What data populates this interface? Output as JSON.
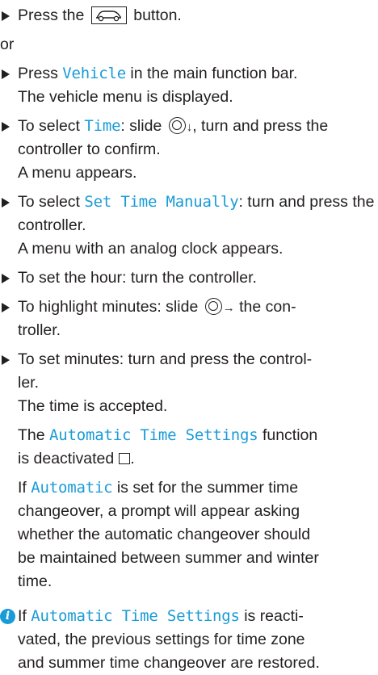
{
  "steps": [
    {
      "pre": "Press the",
      "post": "button.",
      "button_icon": "car-button-icon"
    },
    {
      "or": "or"
    },
    {
      "pre": "Press",
      "term": "Vehicle",
      "post": "in the main function bar.",
      "result": "The vehicle menu is displayed."
    },
    {
      "pre": "To select",
      "term": "Time",
      "mid": ": slide",
      "arrow": "↓",
      "post": ", turn and press the controller to confirm.",
      "result": "A menu appears."
    },
    {
      "pre": "To select",
      "term": "Set Time Manually",
      "post": ": turn and press the controller.",
      "result": "A menu with an analog clock appears."
    },
    {
      "text": "To set the hour: turn the controller."
    },
    {
      "pre": "To highlight minutes: slide",
      "arrow": "→",
      "post": "the con-",
      "post2": "troller."
    },
    {
      "text1": "To set minutes: turn and press the control-",
      "text2": "ler.",
      "result": "The time is accepted."
    }
  ],
  "notes": {
    "n1_term": "Automatic Time Settings",
    "n1_post": "function",
    "n1_line2": "is deactivated",
    "n2_term": "Automatic",
    "n2_post": "is set for the summer time",
    "n2_pre": "If",
    "n2_l2": "changeover, a prompt will appear asking",
    "n2_l3": "whether the automatic changeover should",
    "n2_l4": "be maintained between summer and winter",
    "n2_l5": "time."
  },
  "info": {
    "icon": "i",
    "pre": "If",
    "term": "Automatic Time Settings",
    "post": "is reacti-",
    "l2": "vated, the previous settings for time zone",
    "l3": "and summer time changeover are restored."
  },
  "colors": {
    "accent": "#1a9bd7",
    "text": "#231f20"
  }
}
